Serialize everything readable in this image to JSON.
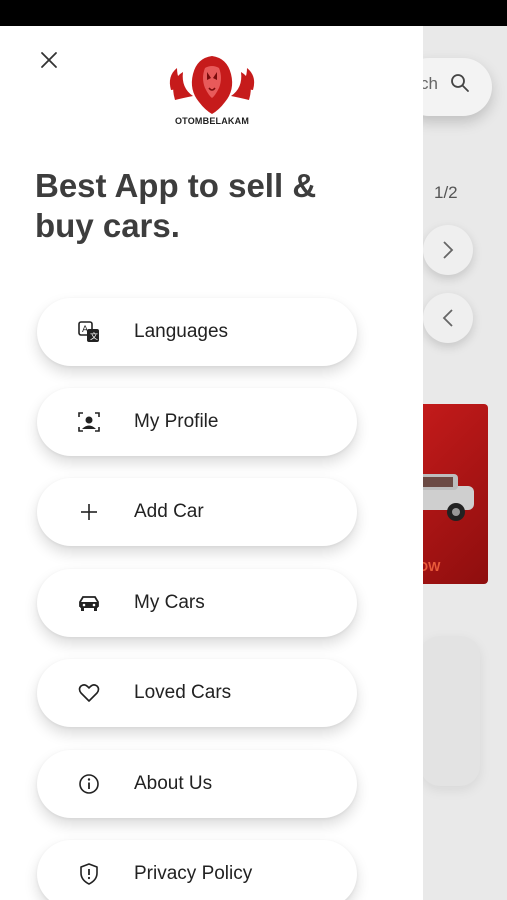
{
  "background": {
    "search_label": "ch",
    "pager": "1/2",
    "banner_label": "OW"
  },
  "drawer": {
    "logo_text": "OTOMBELAKAM",
    "tagline": "Best App to sell & buy cars.",
    "menu": [
      {
        "label": "Languages",
        "icon": "translate-icon"
      },
      {
        "label": "My Profile",
        "icon": "profile-icon"
      },
      {
        "label": "Add Car",
        "icon": "plus-icon"
      },
      {
        "label": "My Cars",
        "icon": "car-icon"
      },
      {
        "label": "Loved Cars",
        "icon": "heart-icon"
      },
      {
        "label": "About Us",
        "icon": "info-icon"
      },
      {
        "label": "Privacy Policy",
        "icon": "shield-icon"
      }
    ]
  },
  "colors": {
    "brand_red": "#c61b1b",
    "drawer_bg": "#ffffff",
    "text_dark": "#3d3d3d"
  }
}
